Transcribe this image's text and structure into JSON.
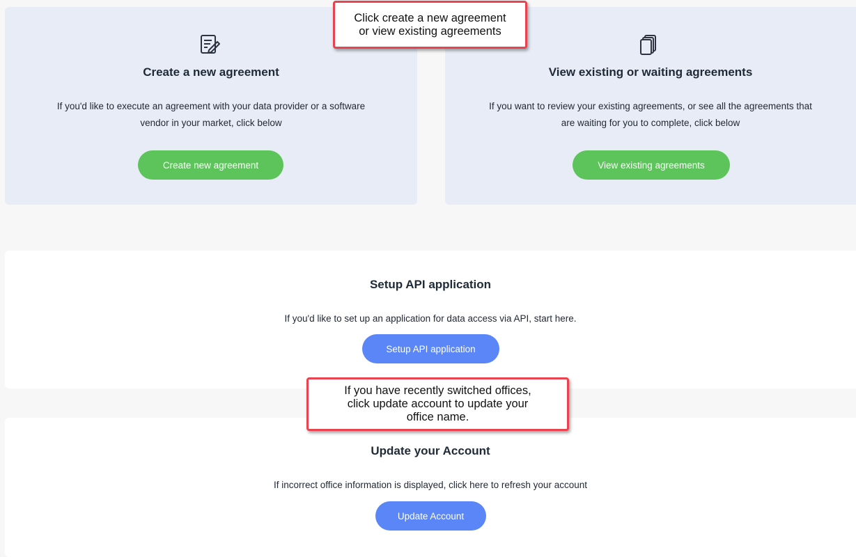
{
  "create_card": {
    "icon": "edit-document-icon",
    "title": "Create a new agreement",
    "desc_line1": "If you'd like to execute an agreement with your data provider or a software",
    "desc_line2": "vendor in your market, click below",
    "button_label": "Create new agreement"
  },
  "view_card": {
    "icon": "documents-stack-icon",
    "title": "View existing or waiting agreements",
    "desc_line1": "If you want to review your existing agreements, or see all the agreements that",
    "desc_line2": "are waiting for you to complete, click below",
    "button_label": "View existing agreements"
  },
  "api_card": {
    "title": "Setup API application",
    "desc": "If you'd like to set up an application for data access via API, start here.",
    "button_label": "Setup API application"
  },
  "update_card": {
    "title": "Update your Account",
    "desc": "If incorrect office information is displayed, click here to refresh your account",
    "button_label": "Update Account"
  },
  "callouts": {
    "top_line1": "Click create a new agreement",
    "top_line2": "or view existing agreements",
    "bottom_line1": "If you have recently switched offices,",
    "bottom_line2": "click update account to update your",
    "bottom_line3": "office name."
  },
  "colors": {
    "card_blue_bg": "#e8ecf6",
    "green_button": "#5cc45a",
    "blue_button": "#5b86f7",
    "callout_border": "#e8434f"
  }
}
